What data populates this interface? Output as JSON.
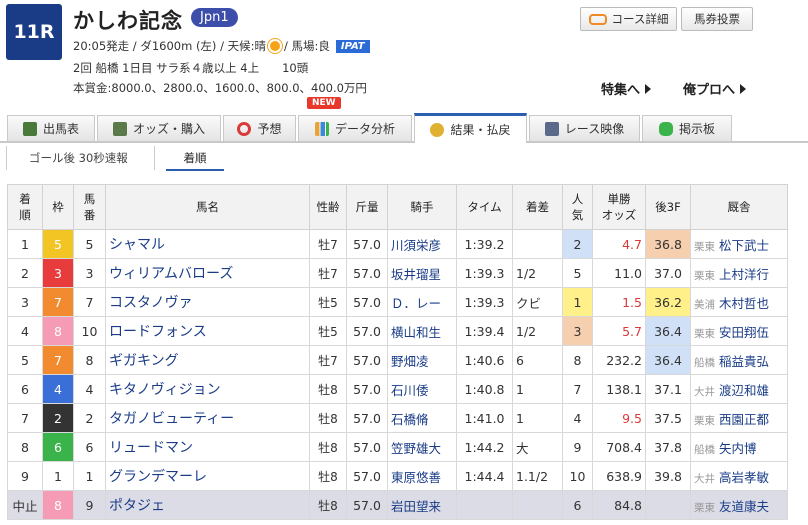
{
  "race": {
    "number": "11R",
    "title": "かしわ記念",
    "grade": "Jpn1",
    "info1_pre": "20:05発走 / ダ1600m (左) / 天候:晴",
    "info1_post": "/ 馬場:良",
    "ipat": "IPAT",
    "info2": "2回 船橋 1日目 サラ系４歳以上 4上　　10頭",
    "info3": "本賞金:8000.0、2800.0、1600.0、800.0、400.0万円"
  },
  "buttons": {
    "course": "コース詳細",
    "vote": "馬券投票"
  },
  "links": {
    "special": "特集へ",
    "orepro": "俺プロへ"
  },
  "tabs": [
    {
      "label": "出馬表"
    },
    {
      "label": "オッズ・購入"
    },
    {
      "label": "予想"
    },
    {
      "label": "データ分析",
      "badge": "NEW"
    },
    {
      "label": "結果・払戻"
    },
    {
      "label": "レース映像"
    },
    {
      "label": "掲示板"
    }
  ],
  "subtabs": {
    "flash": "ゴール後 30秒速報",
    "order": "着順"
  },
  "colors": {
    "frame_1": "#ffffff",
    "frame_2": "#333333",
    "frame_3": "#e83b3b",
    "frame_4": "#3b6fd8",
    "frame_5": "#f2c525",
    "frame_6": "#3ab34a",
    "frame_7": "#f28b30",
    "frame_8": "#f59bb5",
    "accent": "#1a3c87"
  },
  "table": {
    "headers": [
      "着順",
      "枠",
      "馬番",
      "馬名",
      "性齢",
      "斤量",
      "騎手",
      "タイム",
      "着差",
      "人気",
      "単勝オッズ",
      "後3F",
      "厩舎"
    ],
    "header_multiline": {
      "0": "着\n順",
      "2": "馬\n番",
      "9": "人\n気",
      "10": "単勝\nオッズ"
    },
    "rows": [
      {
        "rank": "1",
        "frame": "5",
        "num": "5",
        "horse": "シャマル",
        "sex": "牡7",
        "weight": "57.0",
        "jockey": "川須栄彦",
        "time": "1:39.2",
        "margin": "",
        "pop": "2",
        "odds": "4.7",
        "last3f": "36.8",
        "region": "栗東",
        "trainer": "松下武士"
      },
      {
        "rank": "2",
        "frame": "3",
        "num": "3",
        "horse": "ウィリアムバローズ",
        "sex": "牡7",
        "weight": "57.0",
        "jockey": "坂井瑠星",
        "time": "1:39.3",
        "margin": "1/2",
        "pop": "5",
        "odds": "11.0",
        "last3f": "37.0",
        "region": "栗東",
        "trainer": "上村洋行"
      },
      {
        "rank": "3",
        "frame": "7",
        "num": "7",
        "horse": "コスタノヴァ",
        "sex": "牡5",
        "weight": "57.0",
        "jockey": "Ｄ．レー",
        "time": "1:39.3",
        "margin": "クビ",
        "pop": "1",
        "odds": "1.5",
        "last3f": "36.2",
        "region": "美浦",
        "trainer": "木村哲也"
      },
      {
        "rank": "4",
        "frame": "8",
        "num": "10",
        "horse": "ロードフォンス",
        "sex": "牡5",
        "weight": "57.0",
        "jockey": "横山和生",
        "time": "1:39.4",
        "margin": "1/2",
        "pop": "3",
        "odds": "5.7",
        "last3f": "36.4",
        "region": "栗東",
        "trainer": "安田翔伍"
      },
      {
        "rank": "5",
        "frame": "7",
        "num": "8",
        "horse": "ギガキング",
        "sex": "牡7",
        "weight": "57.0",
        "jockey": "野畑凌",
        "time": "1:40.6",
        "margin": "6",
        "pop": "8",
        "odds": "232.2",
        "last3f": "36.4",
        "region": "船橋",
        "trainer": "稲益貴弘"
      },
      {
        "rank": "6",
        "frame": "4",
        "num": "4",
        "horse": "キタノヴィジョン",
        "sex": "牡8",
        "weight": "57.0",
        "jockey": "石川倭",
        "time": "1:40.8",
        "margin": "1",
        "pop": "7",
        "odds": "138.1",
        "last3f": "37.1",
        "region": "大井",
        "trainer": "渡辺和雄"
      },
      {
        "rank": "7",
        "frame": "2",
        "num": "2",
        "horse": "タガノビューティー",
        "sex": "牡8",
        "weight": "57.0",
        "jockey": "石橋脩",
        "time": "1:41.0",
        "margin": "1",
        "pop": "4",
        "odds": "9.5",
        "last3f": "37.5",
        "region": "栗東",
        "trainer": "西園正都"
      },
      {
        "rank": "8",
        "frame": "6",
        "num": "6",
        "horse": "リュードマン",
        "sex": "牡8",
        "weight": "57.0",
        "jockey": "笠野雄大",
        "time": "1:44.2",
        "margin": "大",
        "pop": "9",
        "odds": "708.4",
        "last3f": "37.8",
        "region": "船橋",
        "trainer": "矢内博"
      },
      {
        "rank": "9",
        "frame": "1",
        "num": "1",
        "horse": "グランデマーレ",
        "sex": "牡8",
        "weight": "57.0",
        "jockey": "東原悠善",
        "time": "1:44.4",
        "margin": "1.1/2",
        "pop": "10",
        "odds": "638.9",
        "last3f": "39.8",
        "region": "大井",
        "trainer": "高岩孝敏"
      },
      {
        "rank": "中止",
        "frame": "8",
        "num": "9",
        "horse": "ポタジェ",
        "sex": "牡8",
        "weight": "57.0",
        "jockey": "岩田望来",
        "time": "",
        "margin": "",
        "pop": "6",
        "odds": "84.8",
        "last3f": "",
        "region": "栗東",
        "trainer": "友道康夫"
      }
    ]
  }
}
